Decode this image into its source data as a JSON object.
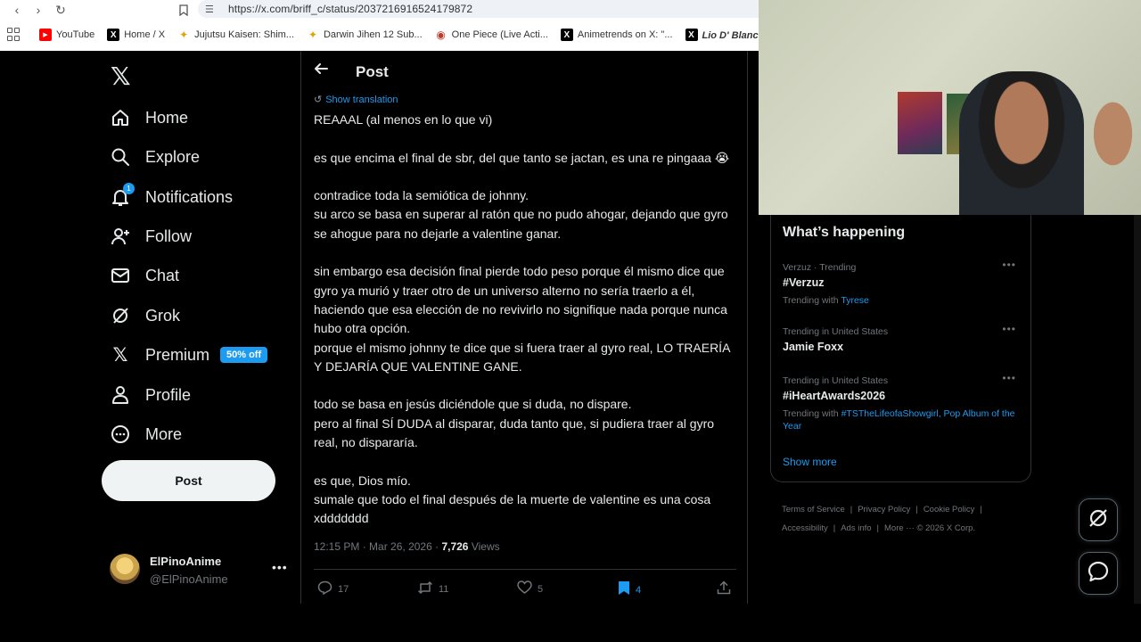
{
  "browser": {
    "url": "https://x.com/briff_c/status/2037216916524179872",
    "bookmarks": [
      {
        "label": "YouTube",
        "icon": "youtube-icon"
      },
      {
        "label": "Home / X",
        "icon": "x-logo-icon"
      },
      {
        "label": "Jujutsu Kaisen: Shim...",
        "icon": "star-icon"
      },
      {
        "label": "Darwin Jihen 12 Sub...",
        "icon": "star-icon"
      },
      {
        "label": "One Piece (Live Acti...",
        "icon": "one-piece-icon"
      },
      {
        "label": "Animetrends on X: \"...",
        "icon": "x-logo-icon"
      },
      {
        "label": "Lio D' Blanco 🏴‍☠️...",
        "icon": "x-logo-icon"
      }
    ]
  },
  "sidebar": {
    "items": [
      {
        "label": "Home",
        "icon": "home-icon"
      },
      {
        "label": "Explore",
        "icon": "search-icon"
      },
      {
        "label": "Notifications",
        "icon": "bell-icon",
        "badge": "1"
      },
      {
        "label": "Follow",
        "icon": "add-user-icon"
      },
      {
        "label": "Chat",
        "icon": "mail-icon"
      },
      {
        "label": "Grok",
        "icon": "grok-icon"
      },
      {
        "label": "Premium",
        "icon": "x-logo-icon",
        "promo": "50% off"
      },
      {
        "label": "Profile",
        "icon": "person-icon"
      },
      {
        "label": "More",
        "icon": "more-circle-icon"
      }
    ],
    "post_label": "Post",
    "account": {
      "name": "ElPinoAnime",
      "handle": "@ElPinoAnime"
    }
  },
  "main": {
    "title": "Post",
    "show_translation": "Show translation",
    "paragraphs": [
      "REAAAL (al menos en lo que vi)",
      "",
      "es que encima el final de sbr, del que tanto se jactan, es una re pingaaa 😭",
      "",
      "contradice toda la semiótica de johnny.",
      "su arco se basa en superar al ratón que no pudo ahogar, dejando que gyro se ahogue para no dejarle a valentine ganar.",
      "",
      "sin embargo esa decisión final pierde todo peso porque él mismo dice que gyro ya murió y traer otro de un universo alterno no sería traerlo a él, haciendo que esa elección de no revivirlo no signifique nada porque nunca hubo otra opción.",
      "porque el mismo johnny te dice que si fuera traer al gyro real, LO TRAERÍA Y DEJARÍA QUE VALENTINE GANE.",
      "",
      "todo se basa en jesús diciéndole que si duda, no dispare.",
      "pero al final SÍ DUDA al disparar, duda tanto que, si pudiera traer al gyro real, no dispararía.",
      "",
      "es que, Dios mío.",
      "sumale que todo el final después de la muerte de valentine es una cosa xddddddd"
    ],
    "meta": {
      "time": "12:15 PM",
      "date": "Mar 26, 2026",
      "views_count": "7,726",
      "views_label": "Views"
    },
    "actions": {
      "replies": "17",
      "reposts": "11",
      "likes": "5",
      "bookmarks": "4"
    }
  },
  "trending": {
    "title": "What’s happening",
    "items": [
      {
        "context": "Verzuz · Trending",
        "name": "#Verzuz",
        "with_label": "Trending with",
        "with_links": "Tyrese"
      },
      {
        "context": "Trending in United States",
        "name": "Jamie Foxx"
      },
      {
        "context": "Trending in United States",
        "name": "#iHeartAwards2026",
        "with_label": "Trending with",
        "with_links": "#TSTheLifeofaShowgirl, Pop Album of the Year"
      }
    ],
    "show_more": "Show more"
  },
  "footer": {
    "links": [
      "Terms of Service",
      "Privacy Policy",
      "Cookie Policy",
      "Accessibility",
      "Ads info",
      "More ···"
    ],
    "copyright": "© 2026 X Corp."
  },
  "colors": {
    "accent": "#1d9bf0",
    "background": "#000000",
    "text": "#e7e9ea",
    "muted": "#71767b",
    "border": "#2f3336"
  }
}
